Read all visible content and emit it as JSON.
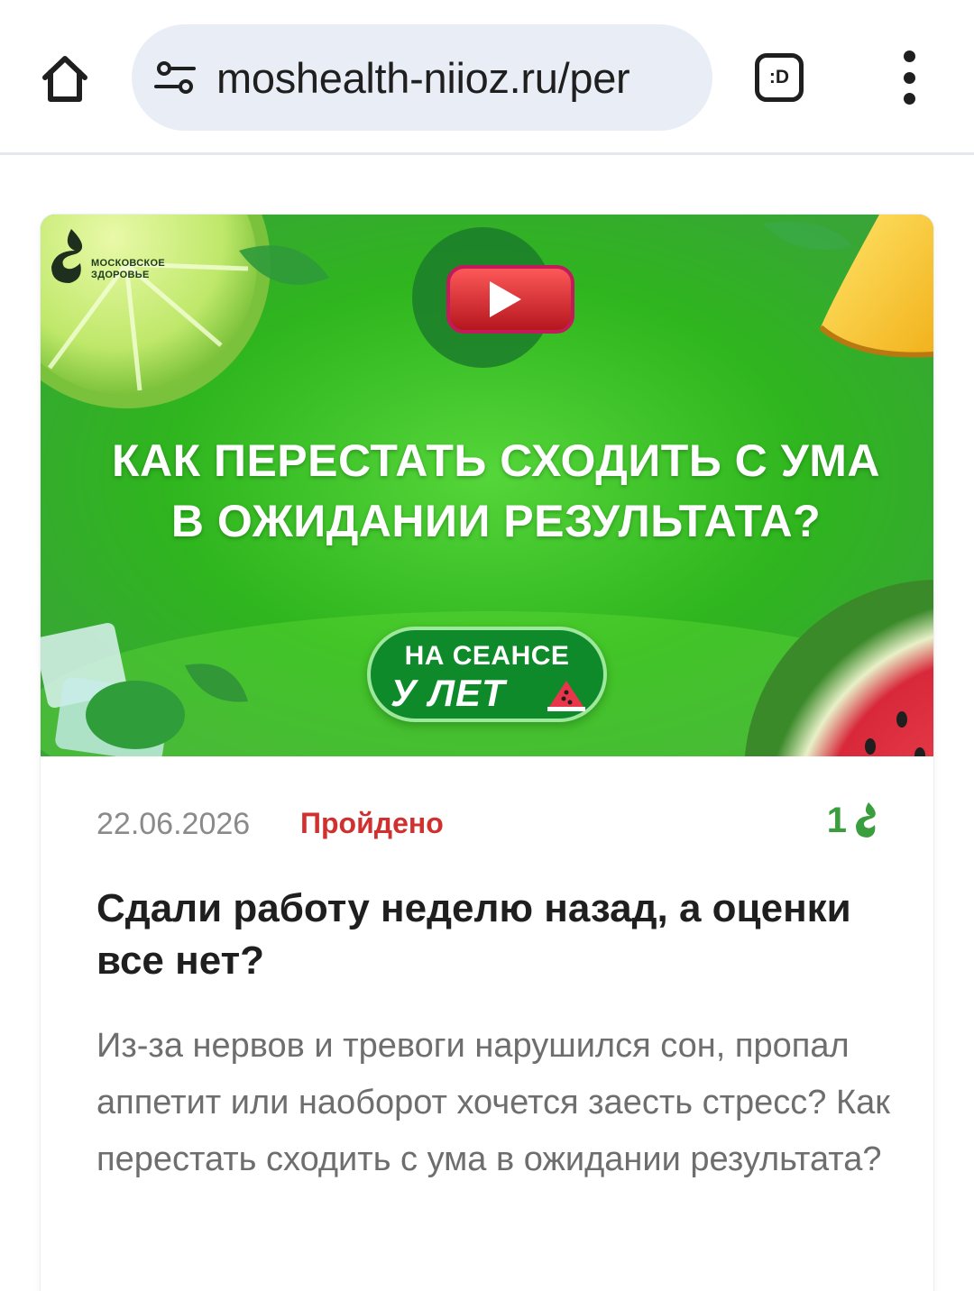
{
  "browser": {
    "url": "moshealth-niioz.ru/per",
    "extension_badge": ":D",
    "icons": {
      "home": "home-icon",
      "site_info": "tune-icon",
      "extension": "extension-badge-icon",
      "menu": "more-vert-icon"
    }
  },
  "card": {
    "banner": {
      "brand_line1": "МОСКОВСКОЕ",
      "brand_line2": "ЗДОРОВЬЕ",
      "headline_line1": "КАК ПЕРЕСТАТЬ СХОДИТЬ С УМА",
      "headline_line2": "В ОЖИДАНИИ РЕЗУЛЬТАТА?",
      "pill_line1": "НА СЕАНСЕ",
      "pill_line2": "У ЛЕТ",
      "icons": [
        "video-play-icon",
        "watermelon-slice-icon"
      ]
    },
    "date": "22.06.2026",
    "status": "Пройдено",
    "status_color": "#d0302f",
    "rating_count": "1",
    "rating_icon": "brand-drop-icon",
    "title": "Сдали работу неделю назад, а оценки все нет?",
    "description": "Из-за нервов и тревоги нарушился сон, пропал аппетит или наоборот хочется заесть стресс? Как перестать сходить с ума в ожидании результата?"
  },
  "colors": {
    "accent_green": "#3a9d3e",
    "banner_green": "#33c51f",
    "text_dark": "#1f1f1f",
    "text_muted": "#6e6e6e"
  }
}
